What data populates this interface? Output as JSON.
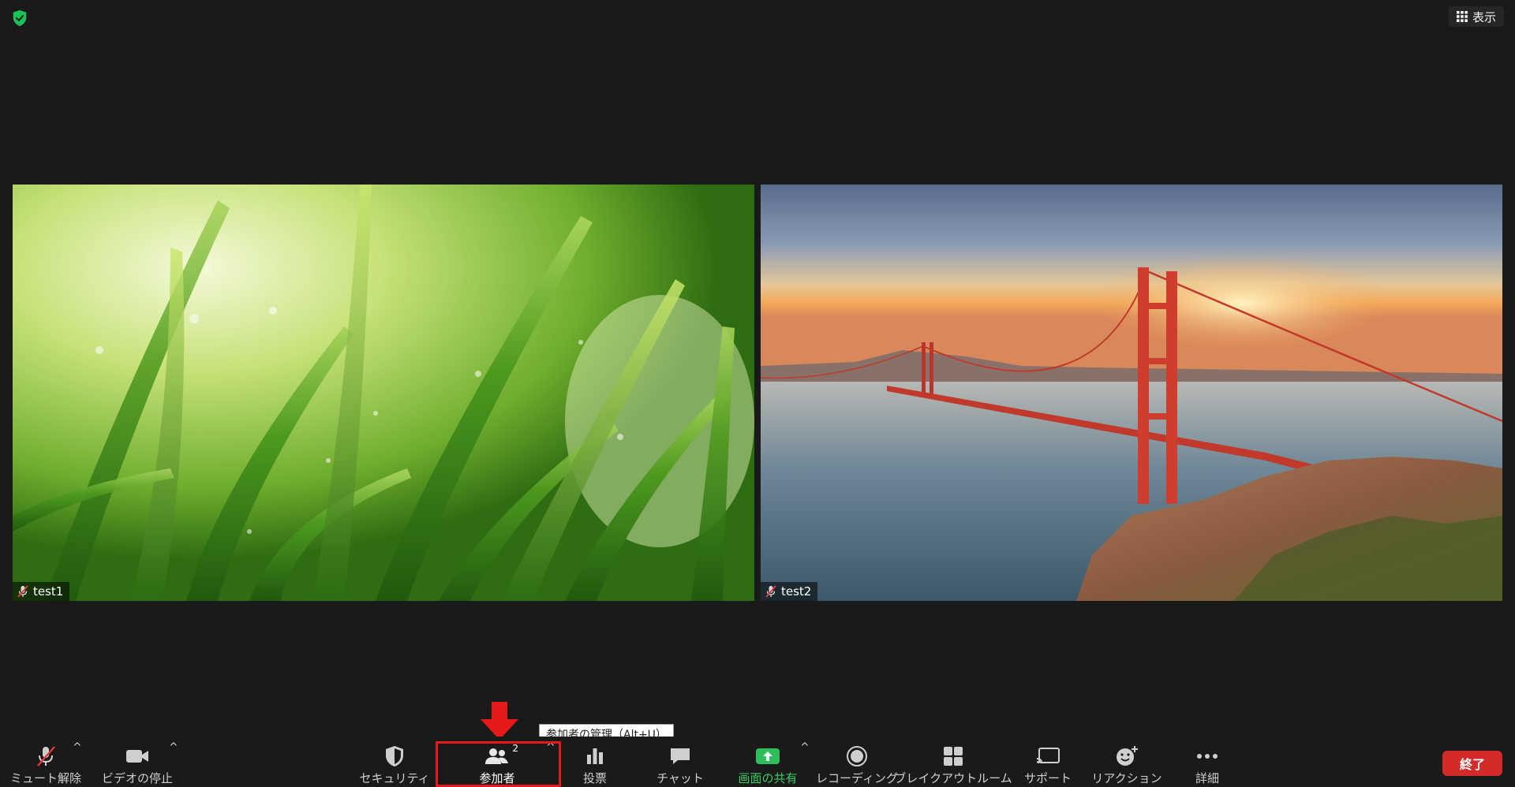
{
  "top_right": {
    "view_label": "表示"
  },
  "participants": [
    {
      "name": "test1"
    },
    {
      "name": "test2"
    }
  ],
  "toolbar": {
    "mute_label": "ミュート解除",
    "video_label": "ビデオの停止",
    "security_label": "セキュリティ",
    "participants_label": "参加者",
    "participants_count": "2",
    "polls_label": "投票",
    "chat_label": "チャット",
    "share_label": "画面の共有",
    "record_label": "レコーディング",
    "breakout_label": "ブレイクアウトルーム",
    "support_label": "サポート",
    "reactions_label": "リアクション",
    "more_label": "詳細",
    "end_label": "終了",
    "caret": "^"
  },
  "tooltip": {
    "text": "参加者の管理（Alt+U）"
  },
  "colors": {
    "accent_green": "#3ccc62",
    "end_red": "#d32a2a",
    "highlight_red": "#e8191a"
  }
}
